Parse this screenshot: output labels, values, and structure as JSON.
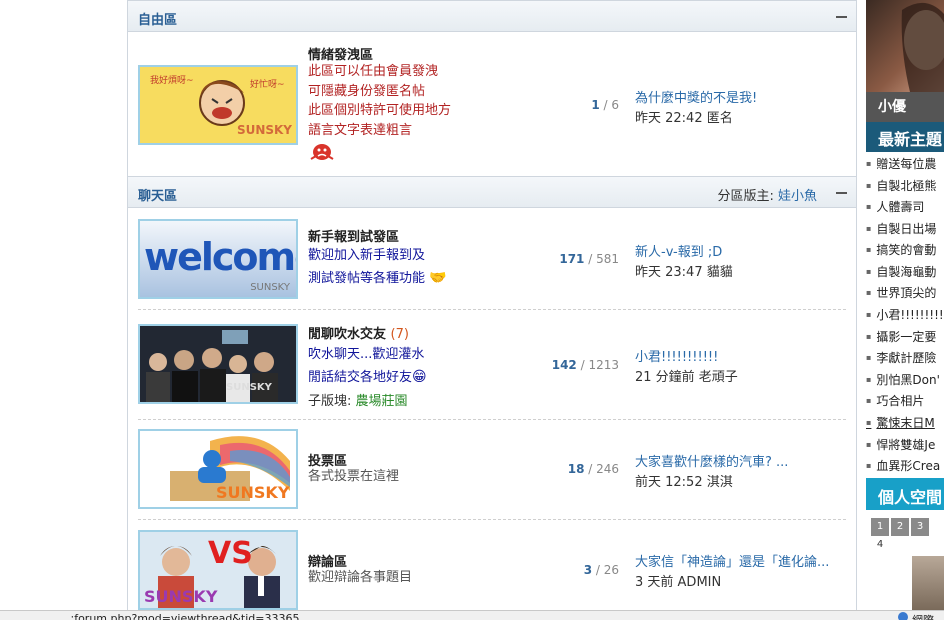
{
  "categories": {
    "free": {
      "title": "自由區",
      "forums": [
        {
          "name": "情緒發洩區",
          "desc": [
            "此區可以任由會員發洩",
            "可隱藏身份發匿名帖",
            "此區個別特許可使用地方",
            "語言文字表達粗言"
          ],
          "thumb_label": "SUNSKY",
          "topics": "1",
          "posts": "6",
          "last_title": "為什麼中獎的不是我!",
          "last_meta": "昨天 22:42 匿名"
        }
      ]
    },
    "chat": {
      "title": "聊天區",
      "moderator_label": "分區版主:",
      "moderator": "娃小魚",
      "forums": [
        {
          "name": "新手報到試發區",
          "desc": [
            "歡迎加入新手報到及",
            "測試發帖等各種功能"
          ],
          "thumb_text": "welcome",
          "thumb_label": "SUNSKY",
          "topics": "171",
          "posts": "581",
          "last_title": "新人-v-報到 ;D",
          "last_meta": "昨天 23:47 貓貓"
        },
        {
          "name": "閒聊吹水交友",
          "count": "(7)",
          "desc": [
            "吹水聊天...歡迎灌水",
            "閒話結交各地好友"
          ],
          "sub_label": "子版塊:",
          "sub_forum": "農場莊園",
          "thumb_label": "SUNSKY",
          "topics": "142",
          "posts": "1213",
          "last_title": "小君!!!!!!!!!!!",
          "last_meta": "21 分鐘前 老頑子"
        },
        {
          "name": "投票區",
          "desc": [
            "各式投票在這裡"
          ],
          "thumb_label": "SUNSKY",
          "topics": "18",
          "posts": "246",
          "last_title": "大家喜歡什麼樣的汽車? ...",
          "last_meta": "前天 12:52 淇淇"
        },
        {
          "name": "辯論區",
          "desc": [
            "歡迎辯論各事題目"
          ],
          "thumb_text": "VS",
          "thumb_label": "SUNSKY",
          "topics": "3",
          "posts": "26",
          "last_title": "大家信「神造論」還是「進化論...",
          "last_meta": "3 天前 ADMIN"
        }
      ]
    }
  },
  "sidebar": {
    "user_name": "小優",
    "latest_title": "最新主題",
    "topics": [
      "贈送每位農",
      "自製北極熊",
      "人體壽司",
      "自製日出場",
      "搞笑的會動",
      "自製海龜動",
      "世界頂尖的",
      "小君!!!!!!!!!!",
      "攝影一定要",
      "李獻計歷險",
      "別怕黑Don'",
      "巧合相片",
      "驚悚末日M",
      "悍將雙雄Je",
      "血異形Crea"
    ],
    "space_title": "個人空間",
    "pages": [
      "1",
      "2",
      "3",
      "4"
    ]
  },
  "statusbar": {
    "url": "...;forum.php?mod=viewthread&tid=33365",
    "right_text": "網際"
  },
  "colors": {
    "category_title": "#2a5f94",
    "link": "#2a6aa8",
    "desc_red": "#b22222",
    "desc_blue": "#10159a",
    "sidebar_dark": "#1b5a7a",
    "sidebar_teal": "#18a0c8"
  }
}
